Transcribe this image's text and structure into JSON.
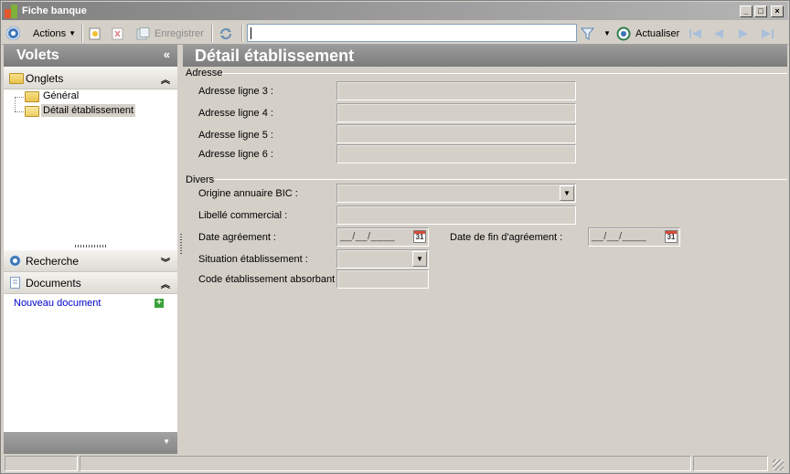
{
  "window": {
    "title": "Fiche banque"
  },
  "toolbar": {
    "actions_label": "Actions",
    "save_label": "Enregistrer",
    "refresh_label": "Actualiser",
    "search_value": ""
  },
  "left": {
    "panel_title": "Volets",
    "tabs_section": {
      "label": "Onglets",
      "items": [
        {
          "label": "Général"
        },
        {
          "label": "Détail établissement"
        }
      ]
    },
    "search_section": {
      "label": "Recherche"
    },
    "documents_section": {
      "label": "Documents",
      "new_document": "Nouveau document"
    }
  },
  "detail": {
    "title": "Détail établissement",
    "adresse": {
      "group_label": "Adresse",
      "fields": [
        {
          "label": "Adresse ligne 3 :",
          "value": ""
        },
        {
          "label": "Adresse ligne 4 :",
          "value": ""
        },
        {
          "label": "Adresse ligne 5 :",
          "value": ""
        },
        {
          "label": "Adresse ligne 6 :",
          "value": ""
        }
      ]
    },
    "divers": {
      "group_label": "Divers",
      "origine_bic": {
        "label": "Origine annuaire BIC :",
        "value": ""
      },
      "libelle_commercial": {
        "label": "Libellé commercial :",
        "value": ""
      },
      "date_agrement": {
        "label": "Date agréement :",
        "mask": "__/__/____",
        "calendar_day": "31"
      },
      "date_fin_agrement": {
        "label": "Date de fin d'agréement :",
        "mask": "__/__/____",
        "calendar_day": "31"
      },
      "situation": {
        "label": "Situation établissement :",
        "value": ""
      },
      "code_absorbant": {
        "label": "Code établissement absorbant :",
        "value": ""
      }
    }
  },
  "colors": {
    "header_gray": "#8c8c8c",
    "window_bg": "#d4d0c8",
    "link_blue": "#0000cc",
    "accent_blue": "#3c74b8"
  }
}
